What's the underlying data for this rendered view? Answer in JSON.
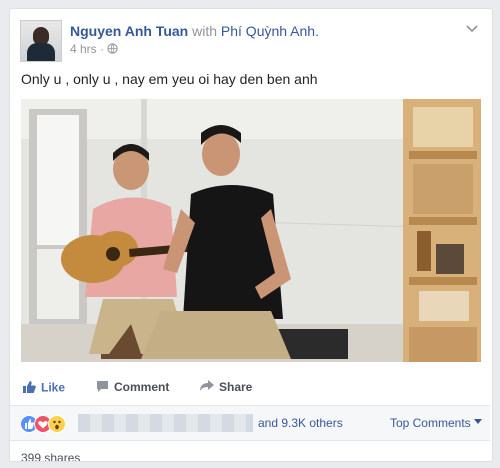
{
  "post": {
    "author": "Nguyen Anh Tuan",
    "with_word": "with",
    "tagged": "Phí Quỳnh Anh.",
    "time": "4 hrs",
    "separator": " · ",
    "text": "Only u , only u , nay em yeu oi hay den ben anh"
  },
  "actions": {
    "like": "Like",
    "comment": "Comment",
    "share": "Share"
  },
  "reactions": {
    "others": "and 9.3K others",
    "top_comments": "Top Comments",
    "shares": "399 shares"
  },
  "colors": {
    "link": "#365899",
    "like_blue": "#5890ff",
    "love_red": "#f25268",
    "wow_yellow": "#fcd04b"
  },
  "icons": [
    "chevron-down-icon",
    "globe-icon",
    "like-icon",
    "comment-icon",
    "share-icon",
    "like-reaction-icon",
    "love-reaction-icon",
    "wow-reaction-icon"
  ]
}
